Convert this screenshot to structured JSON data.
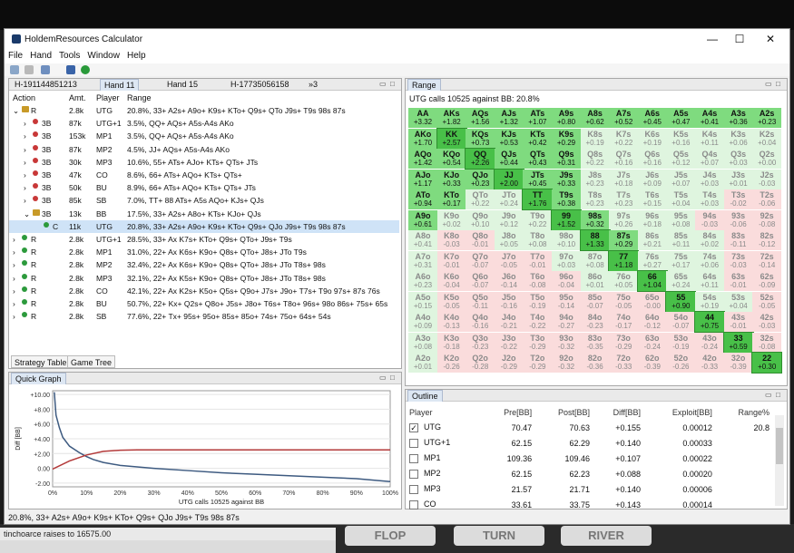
{
  "window": {
    "title": "HoldemResources Calculator",
    "min": "—",
    "max": "☐",
    "close": "✕"
  },
  "menu": [
    "File",
    "Hand",
    "Tools",
    "Window",
    "Help"
  ],
  "hand_tabs": [
    "H-191144851213",
    "Hand 11",
    "Hand 15",
    "H-17735056158",
    "»3"
  ],
  "hands_header": {
    "action": "Action",
    "amt": "Amt.",
    "player": "Player",
    "range": "Range"
  },
  "hands_rows": [
    {
      "indent": 0,
      "exp": "⌄",
      "icon": "lock",
      "act": "R",
      "amt": "2.8k",
      "pl": "UTG",
      "rng": "20.8%, 33+ A2s+ A9o+ K9s+ KTo+ Q9s+ QTo J9s+ T9s 98s 87s"
    },
    {
      "indent": 1,
      "exp": "›",
      "icon": "red",
      "act": "3B",
      "amt": "87k",
      "pl": "UTG+1",
      "rng": "3.5%, QQ+ AQs+ A5s-A4s AKo"
    },
    {
      "indent": 1,
      "exp": "›",
      "icon": "red",
      "act": "3B",
      "amt": "153k",
      "pl": "MP1",
      "rng": "3.5%, QQ+ AQs+ A5s-A4s AKo"
    },
    {
      "indent": 1,
      "exp": "›",
      "icon": "red",
      "act": "3B",
      "amt": "87k",
      "pl": "MP2",
      "rng": "4.5%, JJ+ AQs+ A5s-A4s AKo"
    },
    {
      "indent": 1,
      "exp": "›",
      "icon": "red",
      "act": "3B",
      "amt": "30k",
      "pl": "MP3",
      "rng": "10.6%, 55+ ATs+ AJo+ KTs+ QTs+ JTs"
    },
    {
      "indent": 1,
      "exp": "›",
      "icon": "red",
      "act": "3B",
      "amt": "47k",
      "pl": "CO",
      "rng": "8.6%, 66+ ATs+ AQo+ KTs+ QTs+"
    },
    {
      "indent": 1,
      "exp": "›",
      "icon": "red",
      "act": "3B",
      "amt": "50k",
      "pl": "BU",
      "rng": "8.9%, 66+ ATs+ AQo+ KTs+ QTs+ JTs"
    },
    {
      "indent": 1,
      "exp": "›",
      "icon": "red",
      "act": "3B",
      "amt": "85k",
      "pl": "SB",
      "rng": "7.0%, TT+ 88 ATs+ A5s AQo+ KJs+ QJs"
    },
    {
      "indent": 1,
      "exp": "⌄",
      "icon": "lock",
      "act": "3B",
      "amt": "13k",
      "pl": "BB",
      "rng": "17.5%, 33+ A2s+ A8o+ KTs+ KJo+ QJs"
    },
    {
      "indent": 2,
      "exp": "",
      "icon": "green",
      "act": "C",
      "amt": "11k",
      "pl": "UTG",
      "rng": "20.8%, 33+ A2s+ A9o+ K9s+ KTo+ Q9s+ QJo J9s+ T9s 98s 87s",
      "sel": true
    },
    {
      "indent": 0,
      "exp": "›",
      "icon": "green",
      "act": "R",
      "amt": "2.8k",
      "pl": "UTG+1",
      "rng": "28.5%, 33+ Ax K7s+ KTo+ Q9s+ QTo+ J9s+ T9s"
    },
    {
      "indent": 0,
      "exp": "›",
      "icon": "green",
      "act": "R",
      "amt": "2.8k",
      "pl": "MP1",
      "rng": "31.0%, 22+ Ax K6s+ K9o+ Q8s+ QTo+ J8s+ JTo T9s"
    },
    {
      "indent": 0,
      "exp": "›",
      "icon": "green",
      "act": "R",
      "amt": "2.8k",
      "pl": "MP2",
      "rng": "32.4%, 22+ Ax K6s+ K9o+ Q8s+ QTo+ J8s+ JTo T8s+ 98s"
    },
    {
      "indent": 0,
      "exp": "›",
      "icon": "green",
      "act": "R",
      "amt": "2.8k",
      "pl": "MP3",
      "rng": "32.1%, 22+ Ax K5s+ K9o+ Q8s+ QTo+ J8s+ JTo T8s+ 98s"
    },
    {
      "indent": 0,
      "exp": "›",
      "icon": "green",
      "act": "R",
      "amt": "2.8k",
      "pl": "CO",
      "rng": "42.1%, 22+ Ax K2s+ K5o+ Q5s+ Q9o+ J7s+ J9o+ T7s+ T9o 97s+ 87s 76s"
    },
    {
      "indent": 0,
      "exp": "›",
      "icon": "green",
      "act": "R",
      "amt": "2.8k",
      "pl": "BU",
      "rng": "50.7%, 22+ Kx+ Q2s+ Q8o+ J5s+ J8o+ T6s+ T8o+ 96s+ 98o 86s+ 75s+ 65s"
    },
    {
      "indent": 0,
      "exp": "›",
      "icon": "green",
      "act": "R",
      "amt": "2.8k",
      "pl": "SB",
      "rng": "77.6%, 22+ Tx+ 95s+ 95o+ 85s+ 85o+ 74s+ 75o+ 64s+ 54s"
    }
  ],
  "bottom_tabs": [
    "Strategy Table",
    "Game Tree"
  ],
  "graph_tab": "Quick Graph",
  "graph": {
    "xlabel": "UTG calls 10525 against BB",
    "ylabel": "Diff [BB]"
  },
  "chart_data": {
    "type": "line",
    "xlabel": "UTG calls 10525 against BB",
    "ylabel": "Diff [BB]",
    "ylim": [
      -2.5,
      10.5
    ],
    "xlim": [
      0,
      100
    ],
    "y_ticks": [
      "+10.00",
      "+8.00",
      "+6.00",
      "+4.00",
      "+2.00",
      "0.00",
      "-2.00"
    ],
    "y_vals": [
      10,
      8,
      6,
      4,
      2,
      0,
      -2
    ],
    "x_ticks": [
      "0%",
      "10%",
      "20%",
      "30%",
      "40%",
      "50%",
      "60%",
      "70%",
      "80%",
      "90%",
      "100%"
    ],
    "series": [
      {
        "color": "#3d5a80",
        "x": [
          0.5,
          1,
          2,
          3,
          5,
          8,
          10,
          12,
          15,
          20,
          30,
          40,
          50,
          60,
          70,
          80,
          90,
          95,
          100
        ],
        "y": [
          10.3,
          7.2,
          5.5,
          4.2,
          3.0,
          2.1,
          1.6,
          1.2,
          0.8,
          0.4,
          0.0,
          -0.3,
          -0.6,
          -0.8,
          -1.0,
          -1.2,
          -1.4,
          -1.6,
          -1.8
        ]
      },
      {
        "color": "#b33a3a",
        "x": [
          0,
          5,
          10,
          15,
          20,
          25,
          30,
          40,
          50,
          60,
          70,
          80,
          90,
          100
        ],
        "y": [
          -0.1,
          1.0,
          1.8,
          2.3,
          2.45,
          2.5,
          2.5,
          2.5,
          2.5,
          2.5,
          2.5,
          2.5,
          2.5,
          2.5
        ]
      }
    ]
  },
  "range_tab": "Range",
  "range_subtitle": "UTG calls 10525 against BB: 20.8%",
  "range_cells": [
    [
      "AA|+3.32|3",
      "AKs|+1.82|3",
      "AQs|+1.56|3",
      "AJs|+1.32|3",
      "ATs|+1.07|3",
      "A9s|+0.80|3",
      "A8s|+0.62|3",
      "A7s|+0.52|3",
      "A6s|+0.45|3",
      "A5s|+0.47|3",
      "A4s|+0.41|3",
      "A3s|+0.36|3",
      "A2s|+0.23|3"
    ],
    [
      "AKo|+1.70|3",
      "KK|+2.57|4",
      "KQs|+0.73|3",
      "KJs|+0.53|3",
      "KTs|+0.42|3",
      "K9s|+0.29|3",
      "K8s|+0.19|1",
      "K7s|+0.22|1",
      "K6s|+0.19|1",
      "K5s|+0.16|1",
      "K4s|+0.11|1",
      "K3s|+0.06|1",
      "K2s|+0.04|1"
    ],
    [
      "AQo|+1.42|3",
      "KQo|+0.54|3",
      "QQ|+2.26|4",
      "QJs|+0.44|3",
      "QTs|+0.43|3",
      "Q9s|+0.31|3",
      "Q8s|+0.22|1",
      "Q7s|+0.16|1",
      "Q6s|+0.16|1",
      "Q5s|+0.12|1",
      "Q4s|+0.07|1",
      "Q3s|+0.03|1",
      "Q2s|+0.00|1"
    ],
    [
      "AJo|+1.17|3",
      "KJo|+0.33|3",
      "QJo|+0.23|3",
      "JJ|+2.00|4",
      "JTs|+0.45|3",
      "J9s|+0.33|3",
      "J8s|+0.23|1",
      "J7s|+0.18|1",
      "J6s|+0.09|1",
      "J5s|+0.07|1",
      "J4s|+0.03|1",
      "J3s|+0.01|1",
      "J2s|-0.03|1"
    ],
    [
      "ATo|+0.94|3",
      "KTo|+0.17|3",
      "QTo|+0.22|1",
      "JTo|+0.24|1",
      "TT|+1.76|4",
      "T9s|+0.38|3",
      "T8s|+0.23|1",
      "T7s|+0.23|1",
      "T6s|+0.15|1",
      "T5s|+0.04|1",
      "T4s|+0.03|1",
      "T3s|-0.02|0",
      "T2s|-0.06|0"
    ],
    [
      "A9o|+0.61|3",
      "K9o|+0.02|1",
      "Q9o|+0.10|1",
      "J9o|+0.12|1",
      "T9o|+0.22|1",
      "99|+1.52|4",
      "98s|+0.32|3",
      "97s|+0.26|1",
      "96s|+0.18|1",
      "95s|+0.08|1",
      "94s|-0.03|0",
      "93s|-0.06|0",
      "92s|-0.08|0"
    ],
    [
      "A8o|+0.41|1",
      "K8o|-0.03|0",
      "Q8o|-0.01|0",
      "J8o|+0.05|1",
      "T8o|+0.08|1",
      "98o|+0.10|1",
      "88|+1.33|4",
      "87s|+0.29|3",
      "86s|+0.21|1",
      "85s|+0.11|1",
      "84s|+0.02|1",
      "83s|-0.11|0",
      "82s|-0.12|0"
    ],
    [
      "A7o|+0.31|1",
      "K7o|-0.01|0",
      "Q7o|-0.07|0",
      "J7o|-0.05|0",
      "T7o|-0.01|0",
      "97o|+0.03|1",
      "87o|+0.08|1",
      "77|+1.18|4",
      "76s|+0.27|1",
      "75s|+0.17|1",
      "74s|+0.06|1",
      "73s|-0.03|0",
      "72s|-0.14|0"
    ],
    [
      "A6o|+0.23|1",
      "K6o|-0.04|0",
      "Q6o|-0.07|0",
      "J6o|-0.14|0",
      "T6o|-0.08|0",
      "96o|-0.04|0",
      "86o|+0.01|1",
      "76o|+0.05|1",
      "66|+1.04|4",
      "65s|+0.24|1",
      "64s|+0.11|1",
      "63s|-0.01|0",
      "62s|-0.09|0"
    ],
    [
      "A5o|+0.15|1",
      "K5o|-0.05|0",
      "Q5o|-0.11|0",
      "J5o|-0.16|0",
      "T5o|-0.19|0",
      "95o|-0.14|0",
      "85o|-0.07|0",
      "75o|-0.05|0",
      "65o|-0.00|0",
      "55|+0.90|4",
      "54s|+0.19|1",
      "53s|+0.04|1",
      "52s|-0.05|0"
    ],
    [
      "A4o|+0.09|1",
      "K4o|-0.13|0",
      "Q4o|-0.16|0",
      "J4o|-0.21|0",
      "T4o|-0.22|0",
      "94o|-0.27|0",
      "84o|-0.23|0",
      "74o|-0.17|0",
      "64o|-0.12|0",
      "54o|-0.07|0",
      "44|+0.75|4",
      "43s|-0.01|0",
      "42s|-0.03|0"
    ],
    [
      "A3o|+0.08|1",
      "K3o|-0.18|0",
      "Q3o|-0.23|0",
      "J3o|-0.22|0",
      "T3o|-0.29|0",
      "93o|-0.32|0",
      "83o|-0.35|0",
      "73o|-0.29|0",
      "63o|-0.24|0",
      "53o|-0.19|0",
      "43o|-0.24|0",
      "33|+0.59|4",
      "32s|-0.08|0"
    ],
    [
      "A2o|+0.01|1",
      "K2o|-0.26|0",
      "Q2o|-0.28|0",
      "J2o|-0.29|0",
      "T2o|-0.29|0",
      "92o|-0.32|0",
      "82o|-0.36|0",
      "72o|-0.33|0",
      "62o|-0.39|0",
      "52o|-0.26|0",
      "42o|-0.33|0",
      "32o|-0.39|0",
      "22|+0.30|4"
    ]
  ],
  "outline_tab": "Outline",
  "outline_header": [
    "Player",
    "Pre[BB]",
    "Post[BB]",
    "Diff[BB]",
    "Exploit[BB]",
    "Range%"
  ],
  "outline_rows": [
    {
      "checked": true,
      "pl": "UTG",
      "pre": "70.47",
      "post": "70.63",
      "diff": "+0.155",
      "exp": "0.00012",
      "rng": "20.8",
      "check": "✓"
    },
    {
      "checked": false,
      "pl": "UTG+1",
      "pre": "62.15",
      "post": "62.29",
      "diff": "+0.140",
      "exp": "0.00033",
      "rng": "",
      "check": ""
    },
    {
      "checked": false,
      "pl": "MP1",
      "pre": "109.36",
      "post": "109.46",
      "diff": "+0.107",
      "exp": "0.00022",
      "rng": "",
      "check": ""
    },
    {
      "checked": false,
      "pl": "MP2",
      "pre": "62.15",
      "post": "62.23",
      "diff": "+0.088",
      "exp": "0.00020",
      "rng": "",
      "check": ""
    },
    {
      "checked": false,
      "pl": "MP3",
      "pre": "21.57",
      "post": "21.71",
      "diff": "+0.140",
      "exp": "0.00006",
      "rng": "",
      "check": ""
    },
    {
      "checked": false,
      "pl": "CO",
      "pre": "33.61",
      "post": "33.75",
      "diff": "+0.143",
      "exp": "0.00014",
      "rng": "",
      "check": ""
    }
  ],
  "status": "20.8%, 33+ A2s+ A9o+ K9s+ KTo+ Q9s+ QJo J9s+ T9s 98s 87s",
  "bg": {
    "title": "tinchoarce raises to 16575.00",
    "chat": "",
    "b1": "FLOP",
    "b2": "TURN",
    "b3": "RIVER"
  }
}
